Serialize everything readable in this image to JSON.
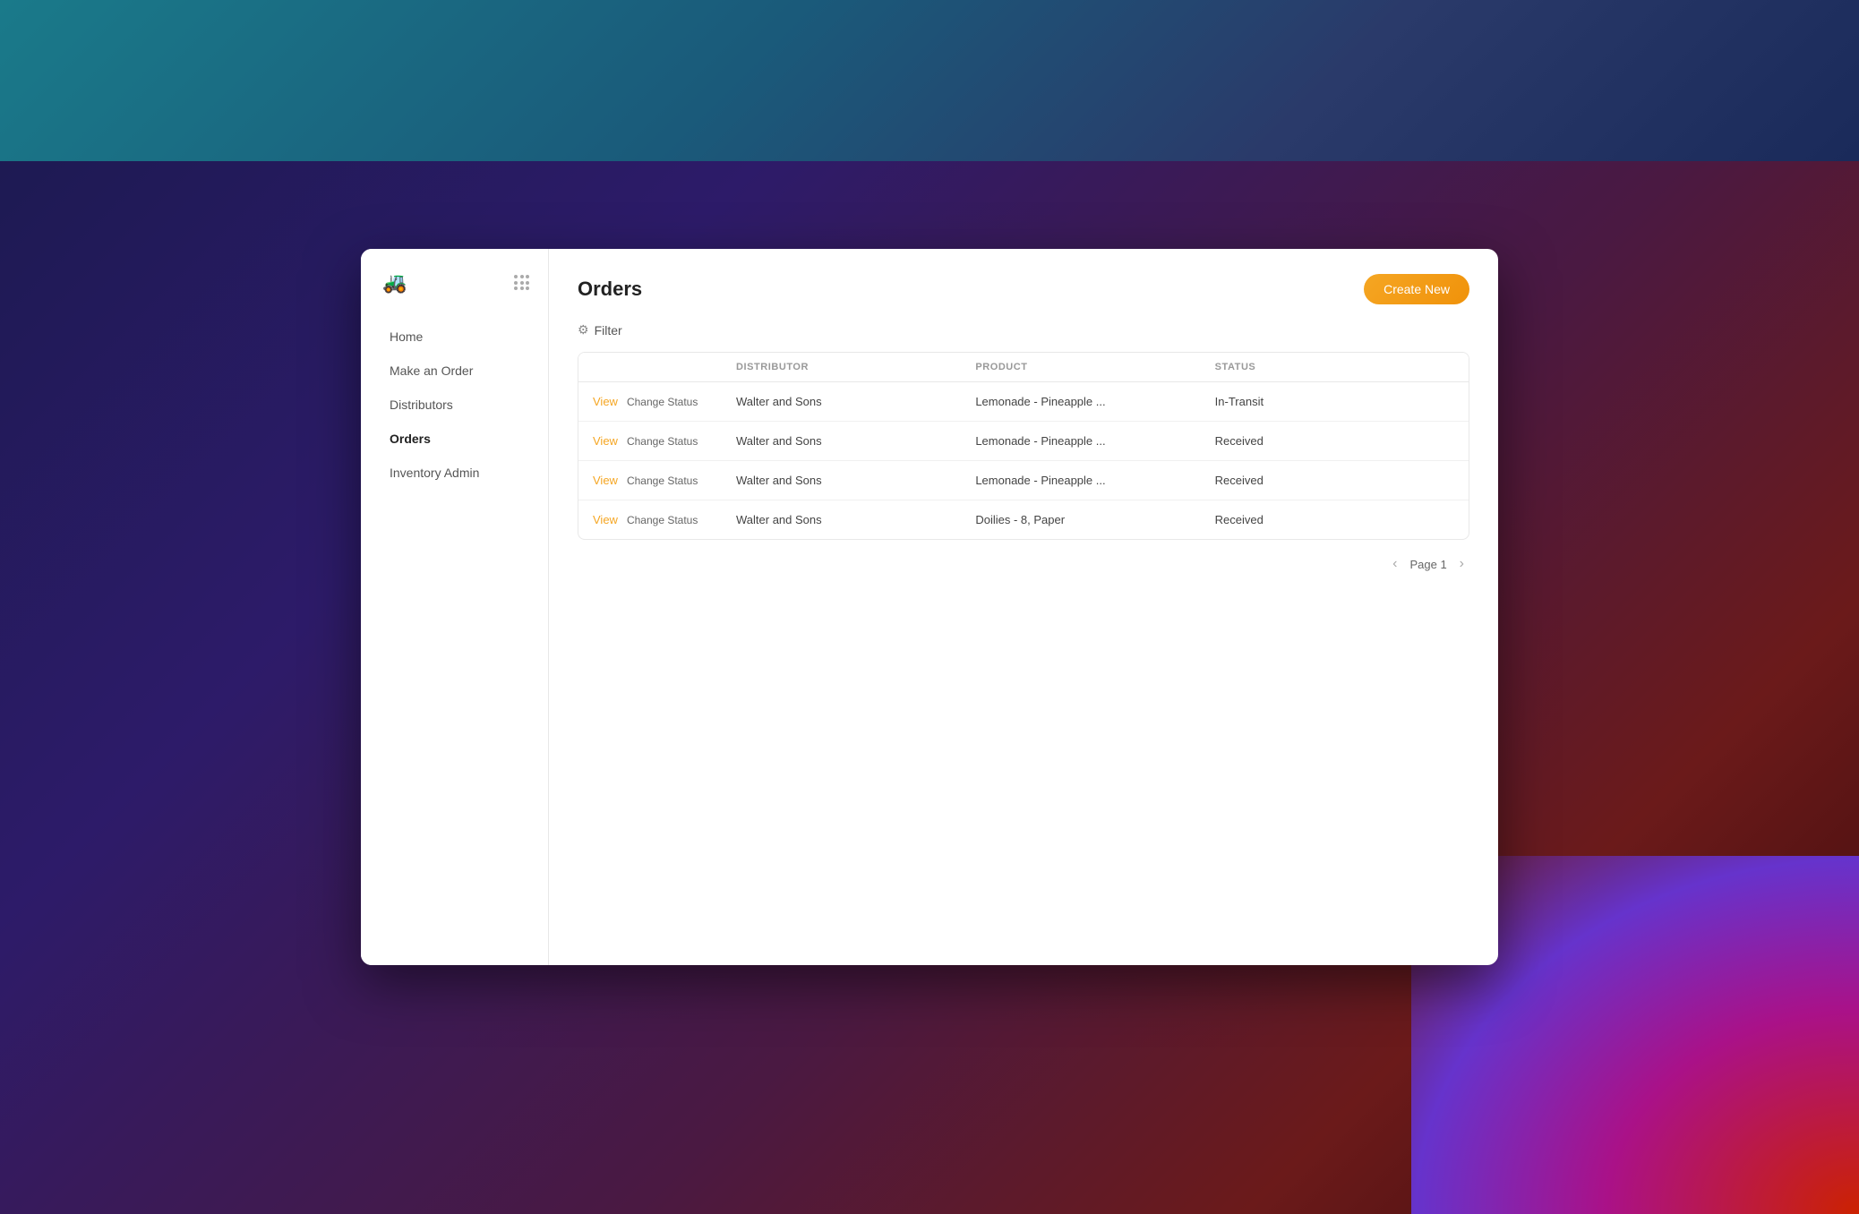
{
  "app": {
    "logo_emoji": "🚜"
  },
  "sidebar": {
    "nav_items": [
      {
        "id": "home",
        "label": "Home",
        "active": false
      },
      {
        "id": "make-an-order",
        "label": "Make an Order",
        "active": false
      },
      {
        "id": "distributors",
        "label": "Distributors",
        "active": false
      },
      {
        "id": "orders",
        "label": "Orders",
        "active": true
      },
      {
        "id": "inventory-admin",
        "label": "Inventory Admin",
        "active": false
      }
    ]
  },
  "header": {
    "title": "Orders",
    "create_button_label": "Create New"
  },
  "filter": {
    "label": "Filter"
  },
  "table": {
    "columns": [
      {
        "id": "actions",
        "label": ""
      },
      {
        "id": "distributor",
        "label": "DISTRIBUTOR"
      },
      {
        "id": "product",
        "label": "PRODUCT"
      },
      {
        "id": "status",
        "label": "STATUS"
      }
    ],
    "rows": [
      {
        "view_label": "View",
        "change_status_label": "Change Status",
        "distributor": "Walter and Sons",
        "product": "Lemonade - Pineapple ...",
        "status": "In-Transit"
      },
      {
        "view_label": "View",
        "change_status_label": "Change Status",
        "distributor": "Walter and Sons",
        "product": "Lemonade - Pineapple ...",
        "status": "Received"
      },
      {
        "view_label": "View",
        "change_status_label": "Change Status",
        "distributor": "Walter and Sons",
        "product": "Lemonade - Pineapple ...",
        "status": "Received"
      },
      {
        "view_label": "View",
        "change_status_label": "Change Status",
        "distributor": "Walter and Sons",
        "product": "Doilies - 8, Paper",
        "status": "Received"
      }
    ]
  },
  "pagination": {
    "page_label": "Page 1",
    "prev_icon": "‹",
    "next_icon": "›"
  }
}
